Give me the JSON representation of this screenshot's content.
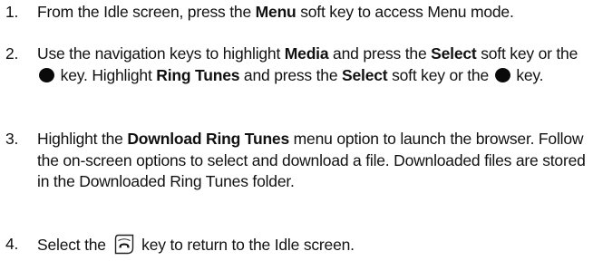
{
  "steps": [
    {
      "number": "1.",
      "t1": "From the Idle screen, press the ",
      "b1": "Menu",
      "t2": " soft key to access Menu mode."
    },
    {
      "number": "2.",
      "t1": "Use the navigation keys to highlight ",
      "b1": "Media",
      "t2": " and press the ",
      "b2": "Select",
      "t3": " soft key or the ",
      "t4": " key. Highlight ",
      "b3": "Ring Tunes",
      "t5": " and press the ",
      "b4": "Select",
      "t6": " soft key or the ",
      "t7": " key."
    },
    {
      "number": "3.",
      "t1": "Highlight the ",
      "b1": "Download Ring Tunes",
      "t2": " menu option to launch the browser. Follow the on-screen options to select and download a file. Downloaded files are stored in the Downloaded Ring Tunes folder."
    },
    {
      "number": "4.",
      "t1": "Select the ",
      "t2": " key to return to the Idle screen."
    }
  ],
  "icons": {
    "select_key": "filled-circle-icon",
    "end_key": "phone-end-key-icon"
  }
}
